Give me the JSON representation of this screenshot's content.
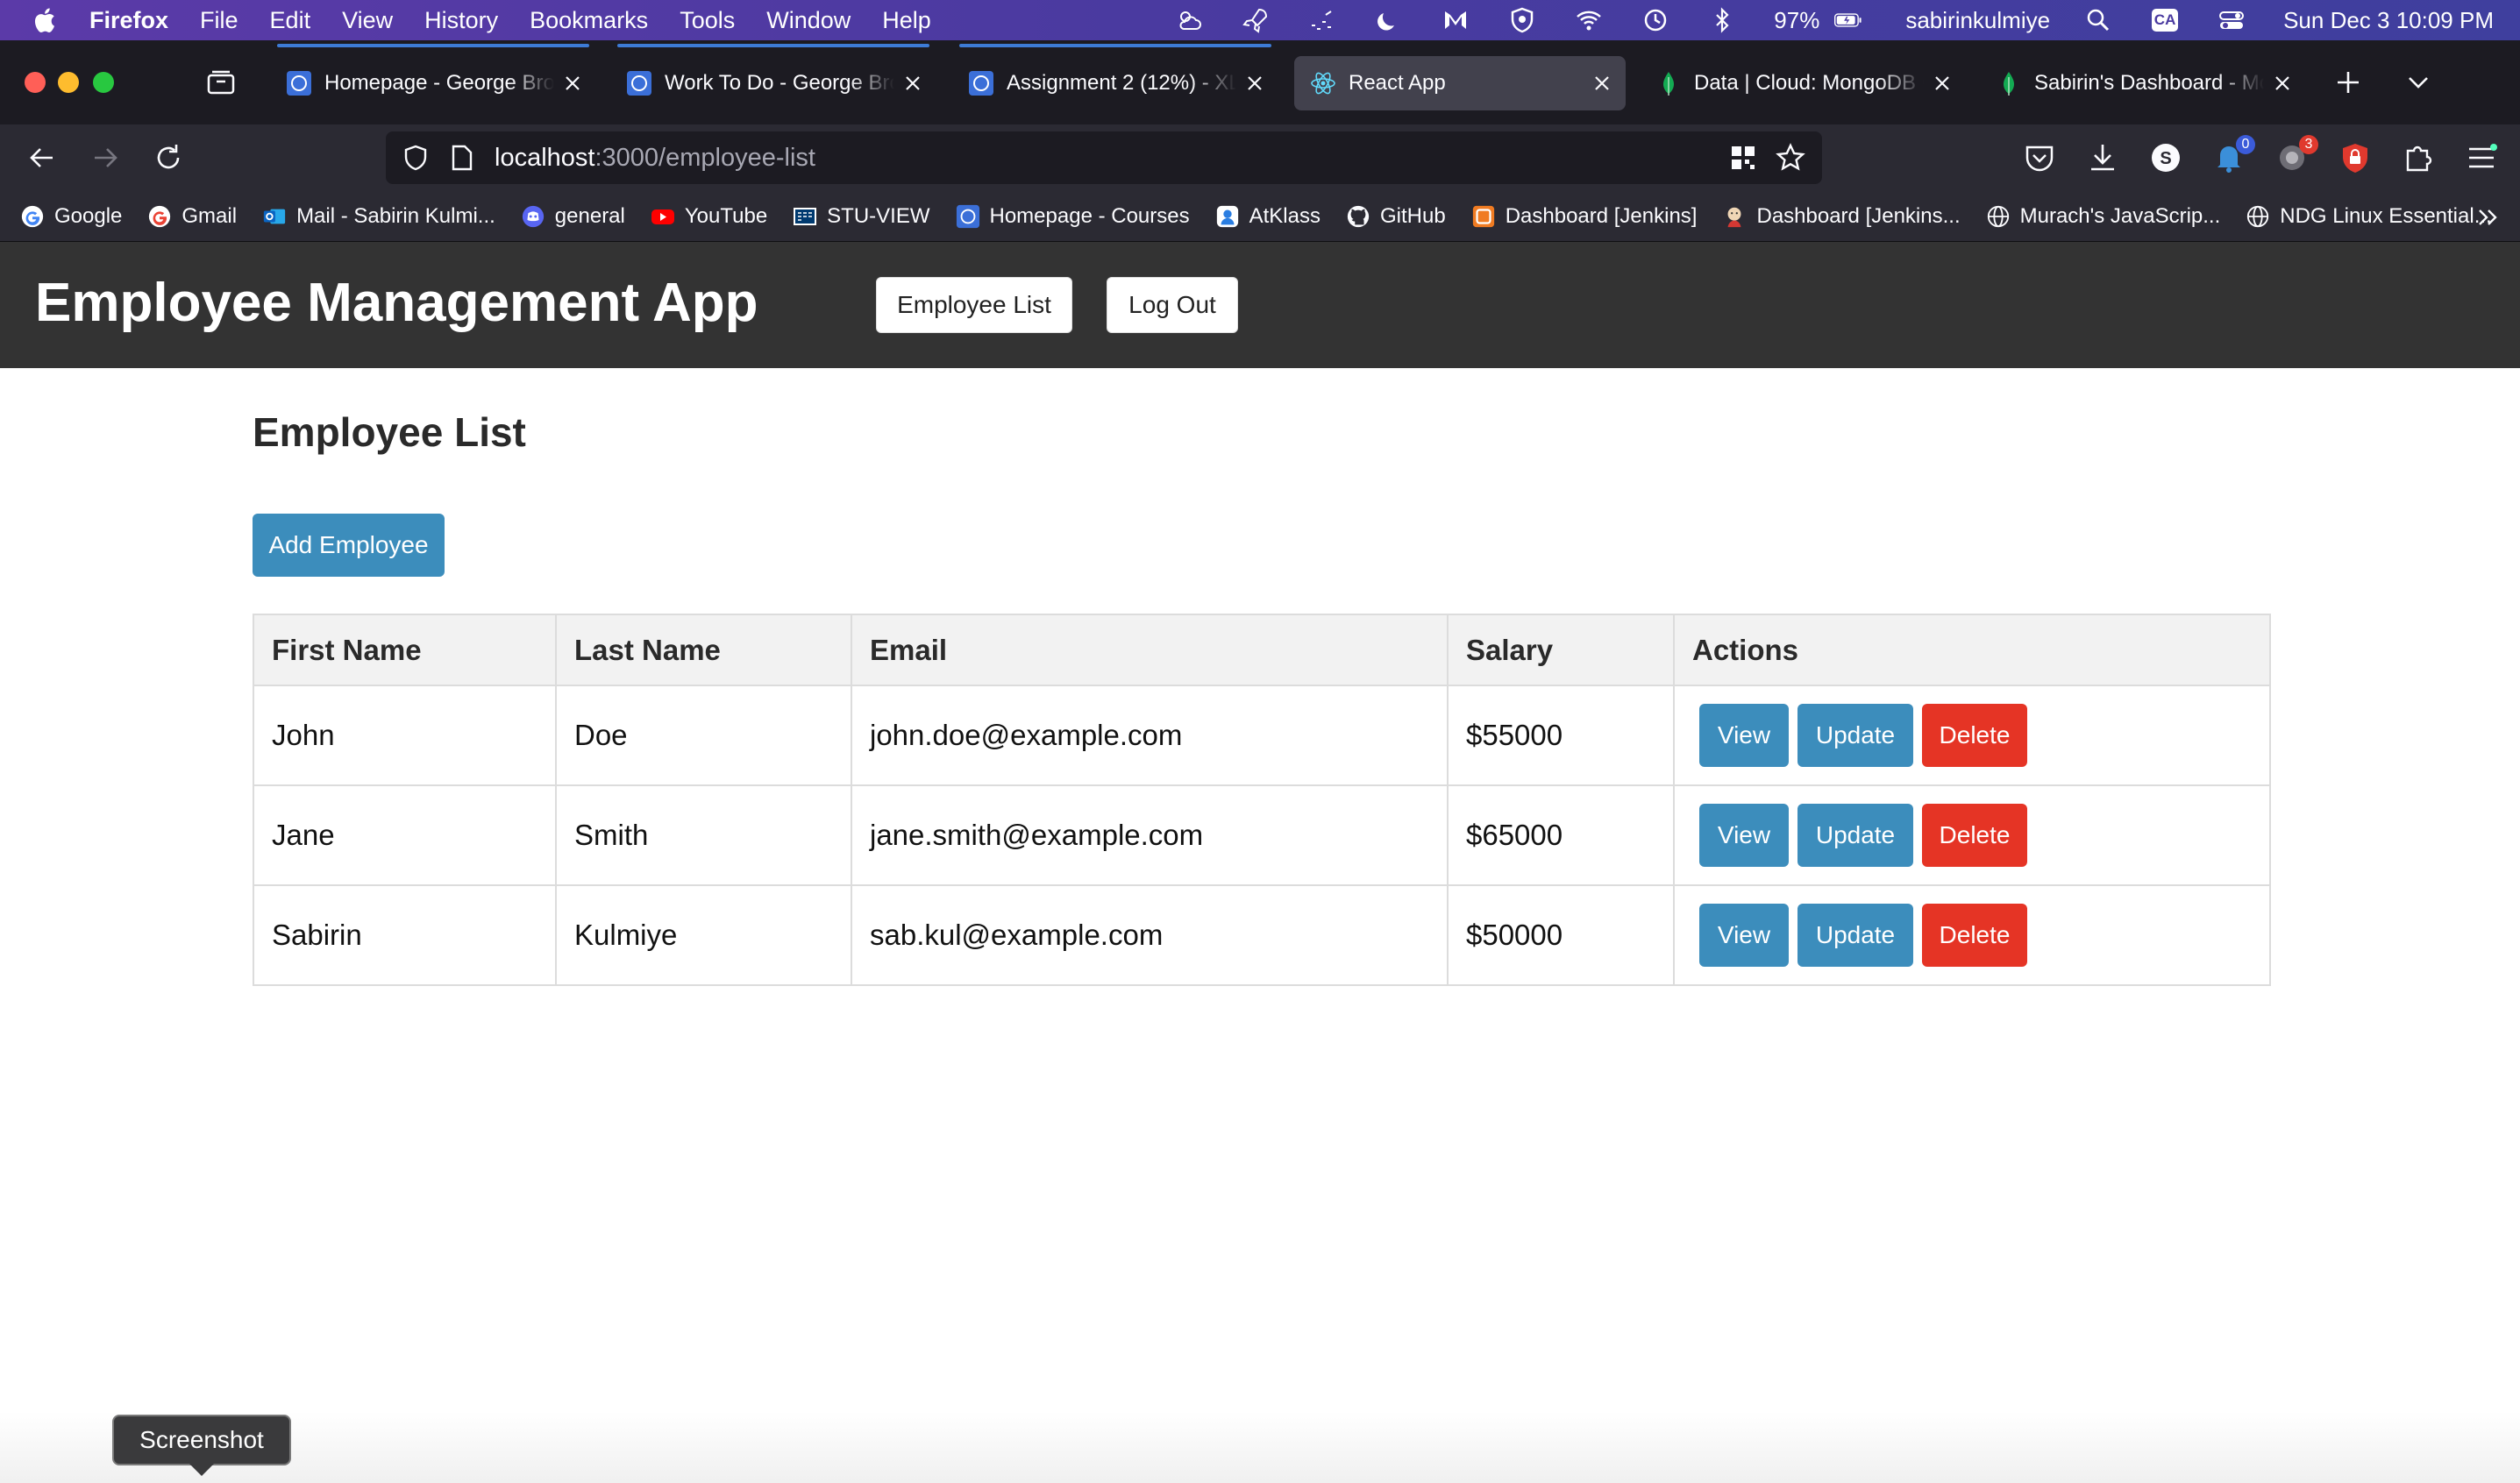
{
  "menubar": {
    "app": "Firefox",
    "items": [
      "File",
      "Edit",
      "View",
      "History",
      "Bookmarks",
      "Tools",
      "Window",
      "Help"
    ],
    "battery": "97%",
    "user": "sabirinkulmiye",
    "input_source": "CA",
    "datetime": "Sun Dec 3  10:09 PM"
  },
  "tabs": [
    {
      "label": "Homepage - George Brown"
    },
    {
      "label": "Work To Do - George Brown"
    },
    {
      "label": "Assignment 2 (12%) - XLIS"
    },
    {
      "label": "React App"
    },
    {
      "label": "Data | Cloud: MongoDB Cloud"
    },
    {
      "label": "Sabirin's Dashboard - MongoDB"
    }
  ],
  "urlbar": {
    "host": "localhost",
    "path": ":3000/employee-list"
  },
  "toolbar": {
    "extension_badge_1": "0",
    "extension_badge_2": "3"
  },
  "bookmarks": [
    {
      "label": "Google"
    },
    {
      "label": "Gmail"
    },
    {
      "label": "Mail - Sabirin Kulmi..."
    },
    {
      "label": "general"
    },
    {
      "label": "YouTube"
    },
    {
      "label": "STU-VIEW"
    },
    {
      "label": "Homepage - Courses"
    },
    {
      "label": "AtKlass"
    },
    {
      "label": "GitHub"
    },
    {
      "label": "Dashboard [Jenkins]"
    },
    {
      "label": "Dashboard [Jenkins..."
    },
    {
      "label": "Murach's JavaScrip..."
    },
    {
      "label": "NDG Linux Essential..."
    }
  ],
  "app": {
    "title": "Employee Management App",
    "nav": {
      "employee_list": "Employee List",
      "log_out": "Log Out"
    },
    "heading": "Employee List",
    "add_button": "Add Employee",
    "columns": [
      "First Name",
      "Last Name",
      "Email",
      "Salary",
      "Actions"
    ],
    "rows": [
      {
        "first": "John",
        "last": "Doe",
        "email": "john.doe@example.com",
        "salary": "$55000"
      },
      {
        "first": "Jane",
        "last": "Smith",
        "email": "jane.smith@example.com",
        "salary": "$65000"
      },
      {
        "first": "Sabirin",
        "last": "Kulmiye",
        "email": "sab.kul@example.com",
        "salary": "$50000"
      }
    ],
    "actions": {
      "view": "View",
      "update": "Update",
      "delete": "Delete"
    }
  },
  "tooltip": "Screenshot",
  "colors": {
    "primary_button": "#3c8dbc",
    "danger_button": "#e53425",
    "header_bg": "#333333"
  }
}
